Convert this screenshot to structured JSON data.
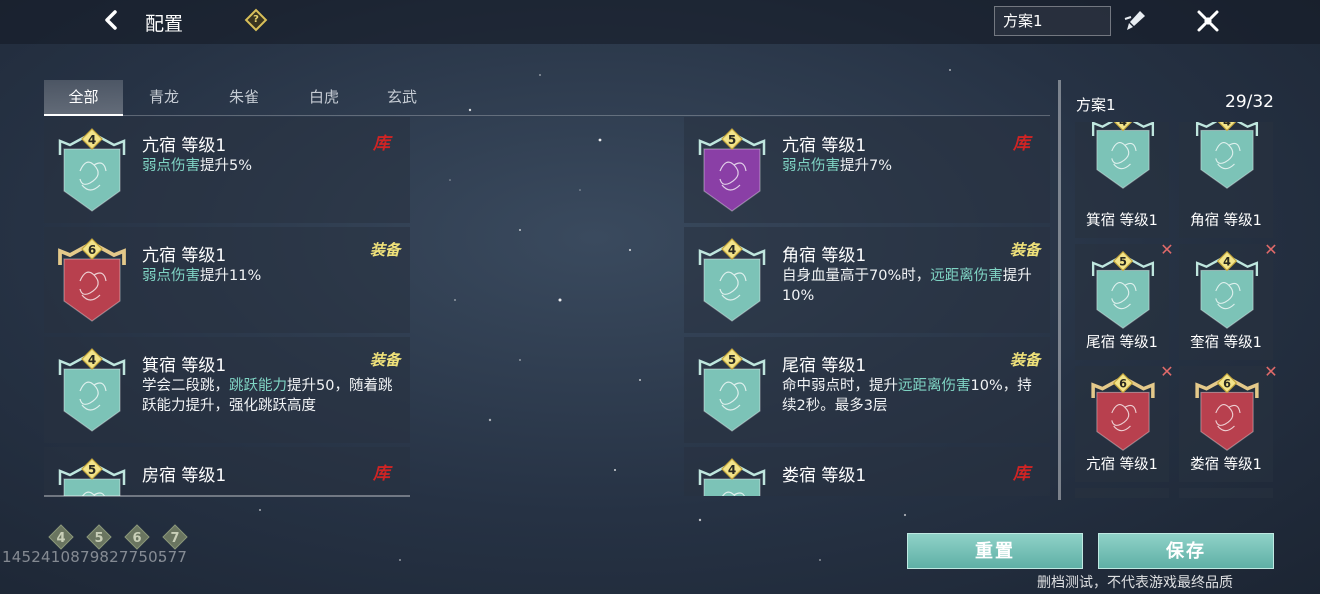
{
  "header": {
    "title": "配置",
    "scheme_value": "方案1"
  },
  "tabs": [
    "全部",
    "青龙",
    "朱雀",
    "白虎",
    "玄武"
  ],
  "cards": [
    {
      "name": "亢宿 等级1",
      "rank": "4",
      "color": "teal",
      "tag": "库",
      "desc": [
        {
          "t": "弱点伤害",
          "hl": true
        },
        {
          "t": "提升5%",
          "hl": false
        }
      ]
    },
    {
      "name": "亢宿 等级1",
      "rank": "5",
      "color": "purple",
      "tag": "库",
      "desc": [
        {
          "t": "弱点伤害",
          "hl": true
        },
        {
          "t": "提升7%",
          "hl": false
        }
      ]
    },
    {
      "name": "亢宿 等级1",
      "rank": "6",
      "color": "red",
      "tag": "装备",
      "desc": [
        {
          "t": "弱点伤害",
          "hl": true
        },
        {
          "t": "提升11%",
          "hl": false
        }
      ]
    },
    {
      "name": "角宿 等级1",
      "rank": "4",
      "color": "teal",
      "tag": "装备",
      "desc": [
        {
          "t": "自身血量高于70%时，",
          "hl": false
        },
        {
          "t": "远距离伤害",
          "hl": true
        },
        {
          "t": "提升10%",
          "hl": false
        }
      ]
    },
    {
      "name": "箕宿 等级1",
      "rank": "4",
      "color": "teal",
      "tag": "装备",
      "desc": [
        {
          "t": "学会二段跳，",
          "hl": false
        },
        {
          "t": "跳跃能力",
          "hl": true
        },
        {
          "t": "提升50，随着跳跃能力提升，强化跳跃高度",
          "hl": false
        }
      ]
    },
    {
      "name": "尾宿 等级1",
      "rank": "5",
      "color": "teal",
      "tag": "装备",
      "desc": [
        {
          "t": "命中弱点时，提升",
          "hl": false
        },
        {
          "t": "远距离伤害",
          "hl": true
        },
        {
          "t": "10%，持续2秒。最多3层",
          "hl": false
        }
      ]
    },
    {
      "name": "房宿 等级1",
      "rank": "5",
      "color": "teal",
      "tag": "库",
      "desc": []
    },
    {
      "name": "娄宿 等级1",
      "rank": "4",
      "color": "teal",
      "tag": "库",
      "desc": []
    }
  ],
  "rank_filters": [
    "4",
    "5",
    "6",
    "7"
  ],
  "uid": "1452410879827750577",
  "loadout": {
    "title": "方案1",
    "count": "29/32",
    "slots": [
      {
        "name": "箕宿 等级1",
        "rank": "4",
        "color": "teal",
        "removable": false
      },
      {
        "name": "角宿 等级1",
        "rank": "4",
        "color": "teal",
        "removable": false
      },
      {
        "name": "尾宿 等级1",
        "rank": "5",
        "color": "teal",
        "removable": true
      },
      {
        "name": "奎宿 等级1",
        "rank": "4",
        "color": "teal",
        "removable": true
      },
      {
        "name": "亢宿 等级1",
        "rank": "6",
        "color": "red",
        "removable": true
      },
      {
        "name": "娄宿 等级1",
        "rank": "6",
        "color": "red",
        "removable": true
      },
      {
        "name": "",
        "rank": "",
        "color": "empty",
        "removable": false
      },
      {
        "name": "",
        "rank": "",
        "color": "empty",
        "removable": false
      }
    ]
  },
  "buttons": {
    "reset": "重置",
    "save": "保存"
  },
  "disclaimer": "删档测试，不代表游戏最终品质",
  "colors": {
    "teal": "#7cc3b7",
    "purple": "#8a3fa6",
    "red": "#b8404e",
    "highlight": "#7fd4c4",
    "equip_tag": "#f0e27a",
    "lib_tag": "#d02424"
  }
}
